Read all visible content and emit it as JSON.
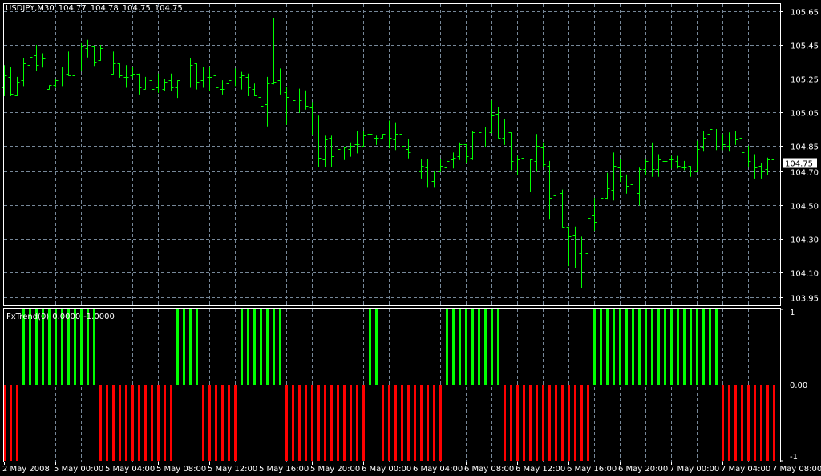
{
  "header": {
    "symbol": "USDJPY,M30",
    "open": "104.77",
    "high": "104.78",
    "low": "104.75",
    "close": "104.75"
  },
  "indicator_label": {
    "name": "FxTrend(0)",
    "value1": "0.0000",
    "value2": "-1.0000"
  },
  "current_price_label": "104.75",
  "colors": {
    "background": "#000000",
    "grid": "#778899",
    "bars": "#00ff00",
    "up": "#00ff00",
    "down": "#ff0000",
    "frame": "#ffffff",
    "current_line": "#778899"
  },
  "chart_data": [
    {
      "type": "ohlc",
      "title": "USDJPY,M30",
      "price_ticks": [
        "105.65",
        "105.45",
        "105.25",
        "105.05",
        "104.85",
        "104.70",
        "104.50",
        "104.30",
        "104.10",
        "103.95"
      ],
      "ylim": [
        103.95,
        105.65
      ],
      "grid": true,
      "current_price": 104.75,
      "x_tick_labels": [
        "2 May 2008",
        "5 May 00:00",
        "5 May 04:00",
        "5 May 08:00",
        "5 May 12:00",
        "5 May 16:00",
        "5 May 20:00",
        "6 May 00:00",
        "6 May 04:00",
        "6 May 08:00",
        "6 May 12:00",
        "6 May 16:00",
        "6 May 20:00",
        "7 May 00:00",
        "7 May 04:00",
        "7 May 08:00"
      ],
      "bars_per_x_label": 8,
      "ohlc": [
        [
          105.2,
          105.33,
          105.15,
          105.27
        ],
        [
          105.26,
          105.32,
          105.15,
          105.16
        ],
        [
          105.15,
          105.26,
          105.15,
          105.23
        ],
        [
          105.24,
          105.37,
          105.21,
          105.34
        ],
        [
          105.33,
          105.38,
          105.3,
          105.38
        ],
        [
          105.39,
          105.45,
          105.3,
          105.33
        ],
        [
          105.32,
          105.4,
          105.32,
          105.37
        ],
        [
          105.19,
          105.21,
          105.19,
          105.21
        ],
        [
          105.21,
          105.25,
          105.2,
          105.24
        ],
        [
          105.25,
          105.32,
          105.21,
          105.32
        ],
        [
          105.28,
          105.41,
          105.27,
          105.27
        ],
        [
          105.27,
          105.32,
          105.26,
          105.3
        ],
        [
          105.3,
          105.46,
          105.3,
          105.44
        ],
        [
          105.43,
          105.48,
          105.38,
          105.42
        ],
        [
          105.44,
          105.44,
          105.33,
          105.35
        ],
        [
          105.36,
          105.45,
          105.36,
          105.43
        ],
        [
          105.42,
          105.42,
          105.26,
          105.3
        ],
        [
          105.28,
          105.41,
          105.28,
          105.34
        ],
        [
          105.34,
          105.34,
          105.26,
          105.27
        ],
        [
          105.26,
          105.33,
          105.2,
          105.26
        ],
        [
          105.27,
          105.32,
          105.26,
          105.28
        ],
        [
          105.28,
          105.28,
          105.16,
          105.2
        ],
        [
          105.19,
          105.26,
          105.19,
          105.25
        ],
        [
          105.24,
          105.28,
          105.18,
          105.19
        ],
        [
          105.2,
          105.28,
          105.17,
          105.18
        ],
        [
          105.19,
          105.25,
          105.18,
          105.23
        ],
        [
          105.24,
          105.28,
          105.18,
          105.2
        ],
        [
          105.2,
          105.24,
          105.14,
          105.24
        ],
        [
          105.25,
          105.32,
          105.21,
          105.3
        ],
        [
          105.3,
          105.37,
          105.2,
          105.33
        ],
        [
          105.34,
          105.34,
          105.19,
          105.23
        ],
        [
          105.24,
          105.32,
          105.2,
          105.25
        ],
        [
          105.26,
          105.32,
          105.18,
          105.26
        ],
        [
          105.27,
          105.27,
          105.18,
          105.2
        ],
        [
          105.19,
          105.24,
          105.16,
          105.19
        ],
        [
          105.22,
          105.28,
          105.14,
          105.24
        ],
        [
          105.25,
          105.31,
          105.21,
          105.25
        ],
        [
          105.26,
          105.29,
          105.19,
          105.27
        ],
        [
          105.26,
          105.28,
          105.15,
          105.2
        ],
        [
          105.19,
          105.22,
          105.15,
          105.15
        ],
        [
          105.14,
          105.19,
          105.04,
          105.09
        ],
        [
          105.1,
          105.26,
          104.97,
          105.22
        ],
        [
          105.22,
          105.61,
          105.22,
          105.23
        ],
        [
          105.24,
          105.31,
          105.16,
          105.18
        ],
        [
          105.17,
          105.2,
          104.98,
          105.14
        ],
        [
          105.13,
          105.2,
          105.1,
          105.12
        ],
        [
          105.13,
          105.19,
          105.05,
          105.12
        ],
        [
          105.13,
          105.18,
          105.07,
          105.09
        ],
        [
          105.08,
          105.11,
          104.92,
          104.99
        ],
        [
          104.99,
          105.03,
          104.73,
          104.78
        ],
        [
          104.77,
          104.91,
          104.73,
          104.89
        ],
        [
          104.9,
          104.91,
          104.73,
          104.79
        ],
        [
          104.8,
          104.88,
          104.75,
          104.83
        ],
        [
          104.82,
          104.84,
          104.77,
          104.84
        ],
        [
          104.83,
          104.87,
          104.79,
          104.85
        ],
        [
          104.86,
          104.94,
          104.81,
          104.86
        ],
        [
          104.85,
          104.94,
          104.85,
          104.91
        ],
        [
          104.92,
          104.94,
          104.88,
          104.92
        ],
        [
          104.9,
          104.91,
          104.86,
          104.9
        ],
        [
          104.9,
          104.92,
          104.9,
          104.92
        ],
        [
          104.94,
          105.0,
          104.84,
          104.9
        ],
        [
          104.89,
          104.99,
          104.83,
          104.92
        ],
        [
          104.92,
          104.97,
          104.79,
          104.85
        ],
        [
          104.83,
          104.89,
          104.78,
          104.81
        ],
        [
          104.8,
          104.8,
          104.63,
          104.68
        ],
        [
          104.7,
          104.77,
          104.66,
          104.73
        ],
        [
          104.72,
          104.77,
          104.61,
          104.65
        ],
        [
          104.64,
          104.7,
          104.61,
          104.68
        ],
        [
          104.7,
          104.77,
          104.7,
          104.73
        ],
        [
          104.72,
          104.78,
          104.71,
          104.76
        ],
        [
          104.77,
          104.81,
          104.72,
          104.78
        ],
        [
          104.79,
          104.87,
          104.77,
          104.86
        ],
        [
          104.86,
          104.86,
          104.75,
          104.79
        ],
        [
          104.78,
          104.94,
          104.77,
          104.93
        ],
        [
          104.94,
          104.96,
          104.86,
          104.93
        ],
        [
          104.94,
          104.96,
          104.85,
          104.94
        ],
        [
          104.93,
          105.12,
          104.93,
          105.03
        ],
        [
          105.04,
          105.08,
          104.9,
          104.9
        ],
        [
          104.9,
          105.01,
          104.86,
          104.94
        ],
        [
          104.93,
          104.93,
          104.71,
          104.76
        ],
        [
          104.75,
          104.79,
          104.68,
          104.77
        ],
        [
          104.78,
          104.81,
          104.63,
          104.68
        ],
        [
          104.68,
          104.77,
          104.58,
          104.77
        ],
        [
          104.76,
          104.92,
          104.7,
          104.85
        ],
        [
          104.84,
          104.87,
          104.73,
          104.74
        ],
        [
          104.73,
          104.76,
          104.42,
          104.54
        ],
        [
          104.56,
          104.58,
          104.35,
          104.58
        ],
        [
          104.57,
          104.59,
          104.37,
          104.37
        ],
        [
          104.37,
          104.37,
          104.14,
          104.31
        ],
        [
          104.32,
          104.37,
          104.13,
          104.22
        ],
        [
          104.21,
          104.31,
          104.01,
          104.22
        ],
        [
          104.21,
          104.47,
          104.16,
          104.42
        ],
        [
          104.44,
          104.54,
          104.35,
          104.4
        ],
        [
          104.39,
          104.54,
          104.39,
          104.54
        ],
        [
          104.54,
          104.69,
          104.54,
          104.6
        ],
        [
          104.59,
          104.81,
          104.53,
          104.73
        ],
        [
          104.72,
          104.77,
          104.64,
          104.67
        ],
        [
          104.68,
          104.68,
          104.57,
          104.61
        ],
        [
          104.62,
          104.63,
          104.51,
          104.58
        ],
        [
          104.57,
          104.72,
          104.5,
          104.71
        ],
        [
          104.71,
          104.77,
          104.68,
          104.76
        ],
        [
          104.75,
          104.87,
          104.67,
          104.71
        ],
        [
          104.71,
          104.8,
          104.67,
          104.77
        ],
        [
          104.76,
          104.78,
          104.72,
          104.76
        ],
        [
          104.77,
          104.79,
          104.72,
          104.77
        ],
        [
          104.76,
          104.79,
          104.72,
          104.73
        ],
        [
          104.72,
          104.76,
          104.71,
          104.72
        ],
        [
          104.73,
          104.73,
          104.67,
          104.68
        ],
        [
          104.7,
          104.88,
          104.7,
          104.83
        ],
        [
          104.84,
          104.94,
          104.82,
          104.9
        ],
        [
          104.92,
          104.96,
          104.86,
          104.95
        ],
        [
          104.94,
          104.95,
          104.83,
          104.87
        ],
        [
          104.87,
          104.92,
          104.83,
          104.86
        ],
        [
          104.85,
          104.93,
          104.82,
          104.87
        ],
        [
          104.87,
          104.94,
          104.86,
          104.89
        ],
        [
          104.9,
          104.91,
          104.77,
          104.81
        ],
        [
          104.8,
          104.85,
          104.73,
          104.76
        ],
        [
          104.75,
          104.8,
          104.66,
          104.72
        ],
        [
          104.73,
          104.75,
          104.66,
          104.7
        ],
        [
          104.71,
          104.78,
          104.68,
          104.77
        ],
        [
          104.77,
          104.78,
          104.75,
          104.75
        ]
      ]
    },
    {
      "type": "bar",
      "title": "FxTrend(0)",
      "ylim": [
        -1,
        1
      ],
      "y_tick_labels": [
        "1",
        "0.00",
        "-1"
      ],
      "values": [
        -1,
        -1,
        -1,
        1,
        1,
        1,
        1,
        1,
        1,
        1,
        1,
        1,
        1,
        1,
        1,
        -1,
        -1,
        -1,
        -1,
        -1,
        -1,
        -1,
        -1,
        -1,
        -1,
        -1,
        -1,
        1,
        1,
        1,
        1,
        -1,
        -1,
        -1,
        -1,
        -1,
        -1,
        1,
        1,
        1,
        1,
        1,
        1,
        1,
        -1,
        -1,
        -1,
        -1,
        -1,
        -1,
        -1,
        -1,
        -1,
        -1,
        -1,
        -1,
        -1,
        1,
        1,
        -1,
        -1,
        -1,
        -1,
        -1,
        -1,
        -1,
        -1,
        -1,
        -1,
        1,
        1,
        1,
        1,
        1,
        1,
        1,
        1,
        1,
        -1,
        -1,
        -1,
        -1,
        -1,
        -1,
        -1,
        -1,
        -1,
        -1,
        -1,
        -1,
        -1,
        -1,
        1,
        1,
        1,
        1,
        1,
        1,
        1,
        1,
        1,
        1,
        1,
        1,
        1,
        1,
        1,
        1,
        1,
        1,
        1,
        1,
        -1,
        -1,
        -1,
        -1,
        -1,
        -1,
        -1,
        -1,
        -1
      ]
    }
  ]
}
